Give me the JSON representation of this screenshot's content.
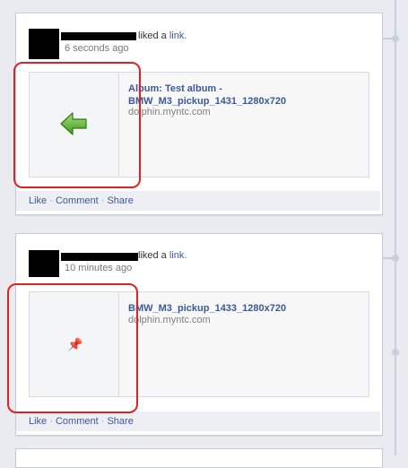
{
  "stories": [
    {
      "action_text": "liked a",
      "link_text": "link.",
      "timestamp": "6 seconds ago",
      "attachment": {
        "title": "Album: Test album - BMW_M3_pickup_1431_1280x720",
        "url": "dolphin.myntc.com",
        "thumbnail_icon": "green-left-arrow-icon"
      },
      "actions": [
        "Like",
        "Comment",
        "Share"
      ]
    },
    {
      "action_text": "liked a",
      "link_text": "link.",
      "timestamp": "10 minutes ago",
      "attachment": {
        "title": "BMW_M3_pickup_1433_1280x720",
        "url": "dolphin.myntc.com",
        "thumbnail_icon": "red-pushpin-icon"
      },
      "actions": [
        "Like",
        "Comment",
        "Share"
      ]
    }
  ],
  "separator": "·",
  "colors": {
    "link": "#3b5998",
    "highlight": "#dd2222",
    "action_bar": "#edeff4"
  }
}
